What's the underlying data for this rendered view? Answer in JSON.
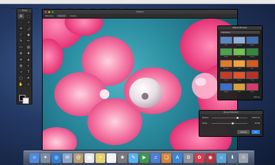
{
  "menubar": {
    "items": [
      "Pixelmator",
      "File",
      "Edit",
      "Image",
      "Layer",
      "Select",
      "Format",
      "Tools",
      "View",
      "Window",
      "Help"
    ]
  },
  "tools_palette": {
    "title": "Tools"
  },
  "window": {
    "title": "Flowers",
    "toolbar": {
      "mode_label": "Blending",
      "mode_value": "Normal",
      "opacity_label": "Opacity"
    }
  },
  "effects_panel": {
    "title": "Effects Browser",
    "category": "Favorites",
    "effects": [
      {
        "label": "Blur",
        "color": "#5a86c8"
      },
      {
        "label": "Gaussian",
        "color": "#8fb0d8"
      },
      {
        "label": "Motion",
        "color": "#3f6fb5"
      },
      {
        "label": "Bloom",
        "color": "#46a34a"
      },
      {
        "label": "Glow",
        "color": "#6fc44d"
      },
      {
        "label": "Vignette",
        "color": "#2f8a3a"
      },
      {
        "label": "Sharpen",
        "color": "#e07b2a"
      },
      {
        "label": "Color",
        "color": "#f2a23b"
      },
      {
        "label": "Hue",
        "color": "#d65a1f"
      },
      {
        "label": "Pinch",
        "color": "#c53a2a"
      },
      {
        "label": "Bump",
        "color": "#e0552d"
      },
      {
        "label": "Twirl",
        "color": "#b8302a"
      },
      {
        "label": "Stripes",
        "color": "#3b6fc9"
      },
      {
        "label": "Stars",
        "color": "#d8a23a"
      },
      {
        "label": "Noise",
        "color": "#d83a6a"
      }
    ],
    "footer": "Effects"
  },
  "dialog": {
    "title": "Bump Distortion",
    "radius_label": "Radius",
    "radius_value": "225.0 px",
    "radius_level": 0.7,
    "scale_label": "Scale",
    "scale_value": "42.00",
    "scale_level": 0.55,
    "cancel_label": "Cancel",
    "ok_label": "OK"
  },
  "dock": {
    "icons": [
      {
        "name": "finder-icon",
        "glyph": "☺",
        "color": "#4a8be0"
      },
      {
        "name": "launchpad-icon",
        "glyph": "✦",
        "color": "#7d8ba3"
      },
      {
        "name": "safari-icon",
        "glyph": "◎",
        "color": "#2e7fd6"
      },
      {
        "name": "mail-icon",
        "glyph": "✉",
        "color": "#8aa4c8"
      },
      {
        "name": "contacts-icon",
        "glyph": "@",
        "color": "#b89a6a"
      },
      {
        "name": "calendar-icon",
        "glyph": "▦",
        "color": "#e8e8e8"
      },
      {
        "name": "notes-icon",
        "glyph": "≡",
        "color": "#e6d26a"
      },
      {
        "name": "reminders-icon",
        "glyph": "✓",
        "color": "#f2f2f2"
      },
      {
        "name": "photos-icon",
        "glyph": "❀",
        "color": "#7a7a7a"
      },
      {
        "name": "messages-icon",
        "glyph": "✎",
        "color": "#5ab2f0"
      },
      {
        "name": "facetime-icon",
        "glyph": "▶",
        "color": "#3a9a4a"
      },
      {
        "name": "itunes-icon",
        "glyph": "♫",
        "color": "#4a7fd6"
      },
      {
        "name": "ibooks-icon",
        "glyph": "❏",
        "color": "#d8843a"
      },
      {
        "name": "appstore-icon",
        "glyph": "A",
        "color": "#3a86d8"
      },
      {
        "name": "systemprefs-icon",
        "glyph": "⚙",
        "color": "#8a8f98"
      },
      {
        "name": "pixelmator-icon",
        "glyph": "✿",
        "color": "#d83a4a"
      },
      {
        "name": "photobooth-icon",
        "glyph": "◉",
        "color": "#b8303a"
      },
      {
        "name": "iphoto-icon",
        "glyph": "☼",
        "color": "#5aa6d8"
      },
      {
        "name": "downloads-icon",
        "glyph": "⬇",
        "color": "#5a6f8f"
      },
      {
        "name": "trash-icon",
        "glyph": "♲",
        "color": "#9aa2ae"
      }
    ]
  }
}
